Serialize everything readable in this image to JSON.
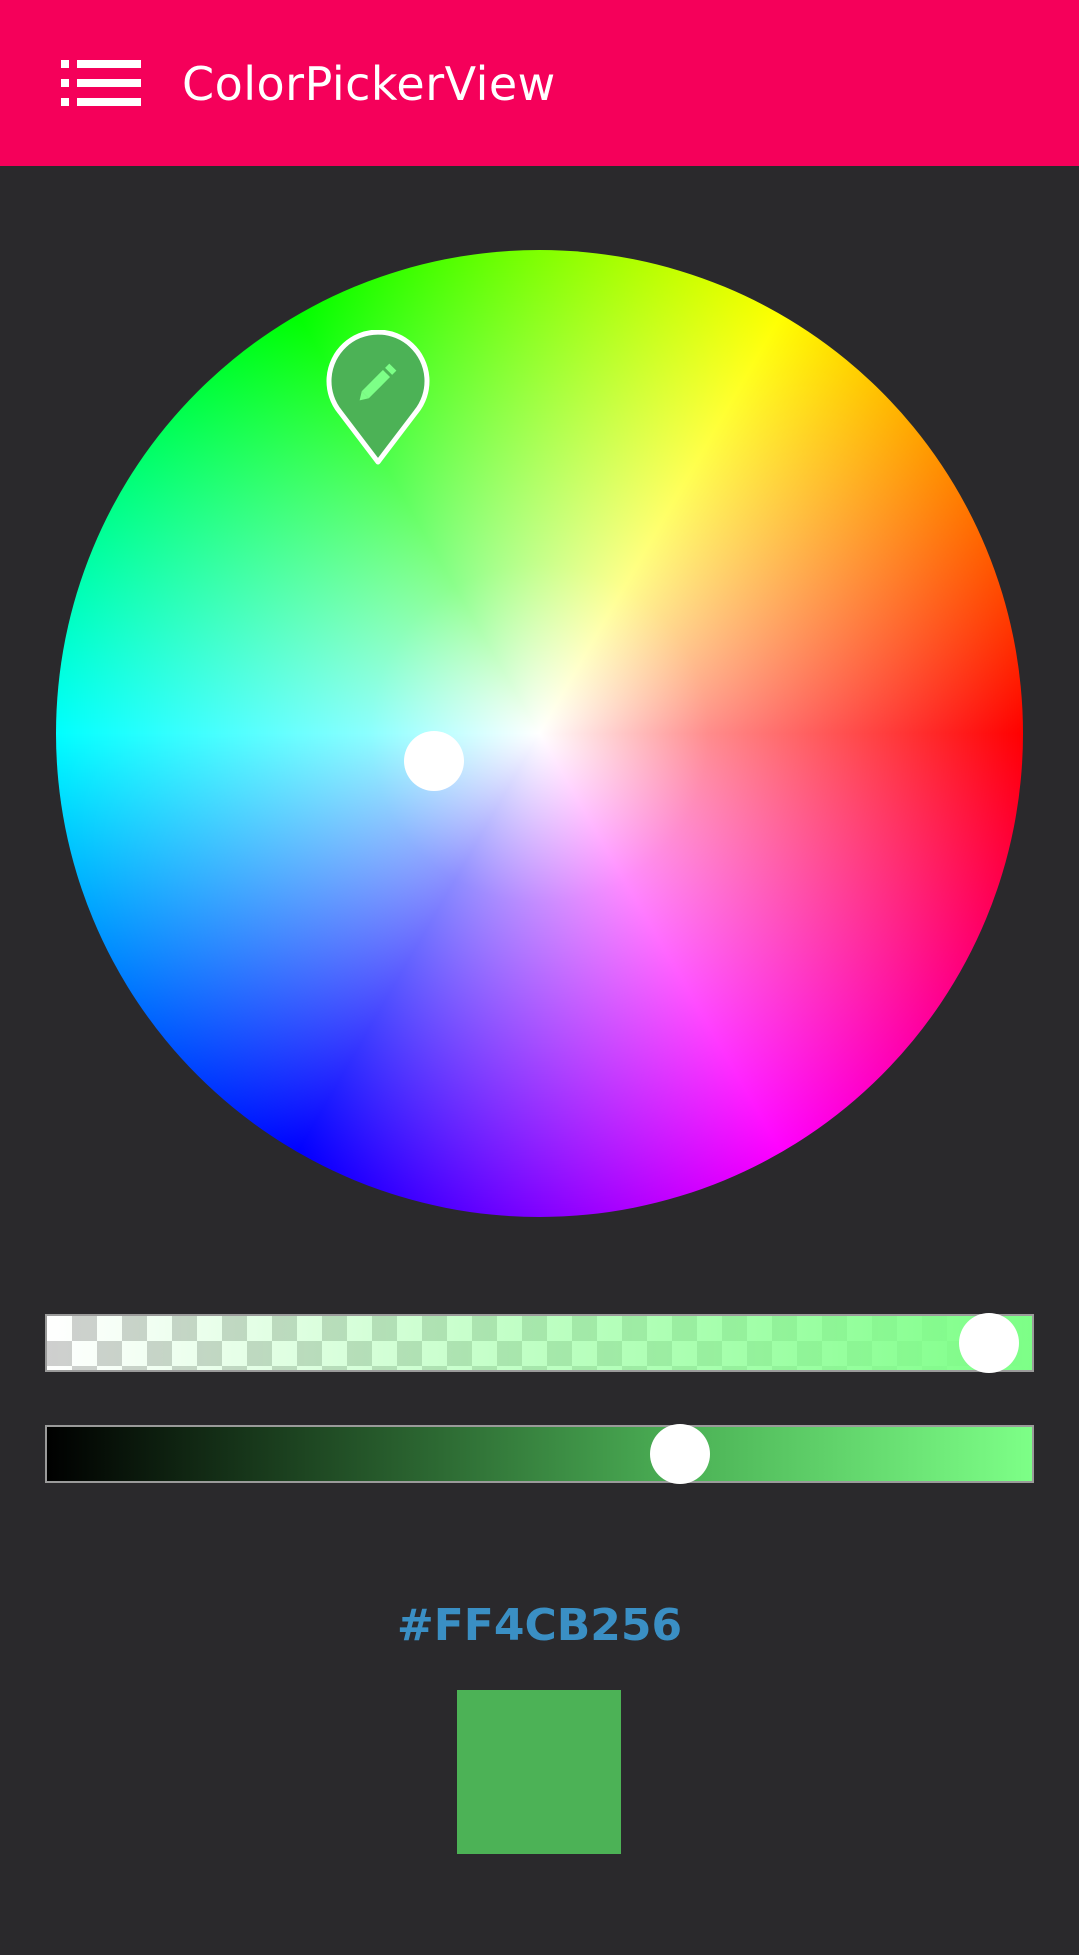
{
  "app_bar": {
    "title": "ColorPickerView",
    "menu_icon": "menu-list-icon",
    "background_color": "#f5005a"
  },
  "color_picker": {
    "selected_color": "#4cb256",
    "flag_icon": "pencil-icon",
    "alpha_value": 1.0,
    "brightness_value": 0.64
  },
  "result": {
    "hex_label": "#FF4CB256",
    "hex_text_color": "#3a8fc4",
    "swatch_color": "#4cb256"
  }
}
